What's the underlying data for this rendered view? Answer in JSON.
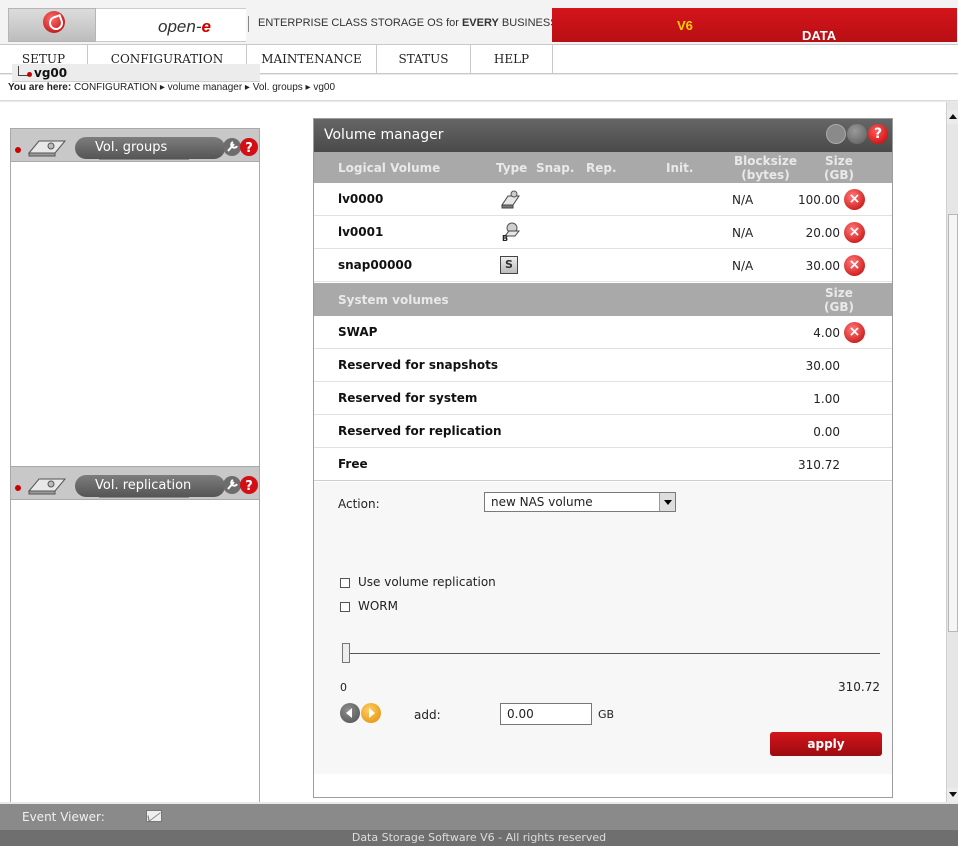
{
  "header": {
    "brand_main": "open-",
    "brand_accent": "e",
    "tagline_pre": "ENTERPRISE CLASS STORAGE OS for ",
    "tagline_bold": "EVERY",
    "tagline_post": " BUSINESS",
    "product": "DATA STORAGE SOFTWARE ",
    "product_version": "V6",
    "accent_color": "#d4151b"
  },
  "menu": [
    {
      "label": "SETUP"
    },
    {
      "label": "CONFIGURATION"
    },
    {
      "label": "MAINTENANCE"
    },
    {
      "label": "STATUS"
    },
    {
      "label": "HELP"
    }
  ],
  "breadcrumb": {
    "prefix": "You are here:",
    "path": "CONFIGURATION ▸ volume manager ▸ Vol. groups ▸ vg00"
  },
  "left_panel": {
    "vol_groups_title": "Vol. groups",
    "tree_item": "vg00",
    "vol_replication_title": "Vol. replication"
  },
  "volume_manager": {
    "title": "Volume manager",
    "columns": {
      "logical_volume": "Logical Volume",
      "type": "Type",
      "snap": "Snap.",
      "rep": "Rep.",
      "init": "Init.",
      "blocksize": "Blocksize",
      "blocksize_unit": "(bytes)",
      "size": "Size",
      "size_unit": "(GB)"
    },
    "logical_volumes": [
      {
        "name": "lv0000",
        "type_icon": "nas-volume-icon",
        "blocksize": "N/A",
        "size": "100.00"
      },
      {
        "name": "lv0001",
        "type_icon": "iscsi-volume-icon",
        "blocksize": "N/A",
        "size": "20.00"
      },
      {
        "name": "snap00000",
        "type_icon": "snapshot-icon",
        "type_glyph": "S",
        "blocksize": "N/A",
        "size": "30.00"
      }
    ],
    "system_header": {
      "title": "System volumes",
      "size": "Size",
      "size_unit": "(GB)"
    },
    "system_volumes": [
      {
        "name": "SWAP",
        "size": "4.00"
      },
      {
        "name": "Reserved for snapshots",
        "size": "30.00"
      },
      {
        "name": "Reserved for system",
        "size": "1.00"
      },
      {
        "name": "Reserved for replication",
        "size": "0.00"
      },
      {
        "name": "Free",
        "size": "310.72"
      }
    ]
  },
  "form": {
    "action_label": "Action:",
    "action_value": "new NAS volume",
    "use_replication_label": "Use volume replication",
    "worm_label": "WORM",
    "slider_min": "0",
    "slider_max": "310.72",
    "slider_fraction": 0,
    "add_label": "add:",
    "add_value": "0.00",
    "add_unit": "GB",
    "apply_label": "apply"
  },
  "footer": {
    "event_viewer": "Event Viewer:",
    "copyright": "Data Storage Software V6 - All rights reserved"
  }
}
